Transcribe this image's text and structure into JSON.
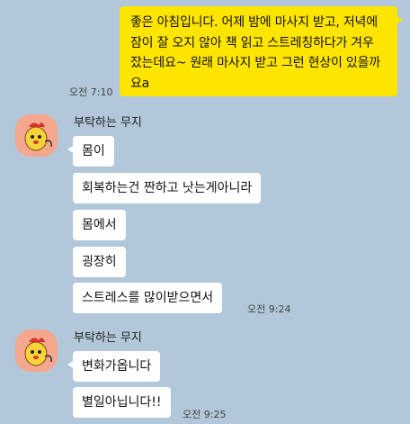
{
  "outgoing": {
    "text": "좋은 아침입니다. 어제 밤에 마사지 받고, 저녁에 잠이 잘 오지 않아 책 읽고 스트레칭하다가 겨우 잤는데요~ 원래 마사지 받고 그런 현상이 있을까요a",
    "time": "오전 7:10"
  },
  "groups": [
    {
      "sender": "부탁하는 무지",
      "messages": [
        "몸이",
        "회복하는건 짠하고 낫는게아니라",
        "몸에서",
        "굉장히",
        "스트레스를 많이받으면서"
      ],
      "time": "오전 9:24"
    },
    {
      "sender": "부탁하는 무지",
      "messages": [
        "변화가옵니다",
        "별일아닙니다!!"
      ],
      "time": "오전 9:25"
    }
  ],
  "colors": {
    "background": "#b2c7d9",
    "my_bubble": "#fee500",
    "their_bubble": "#ffffff",
    "avatar_bg": "#f3a88e"
  },
  "icons": {
    "avatar": "muji-character-avatar"
  }
}
